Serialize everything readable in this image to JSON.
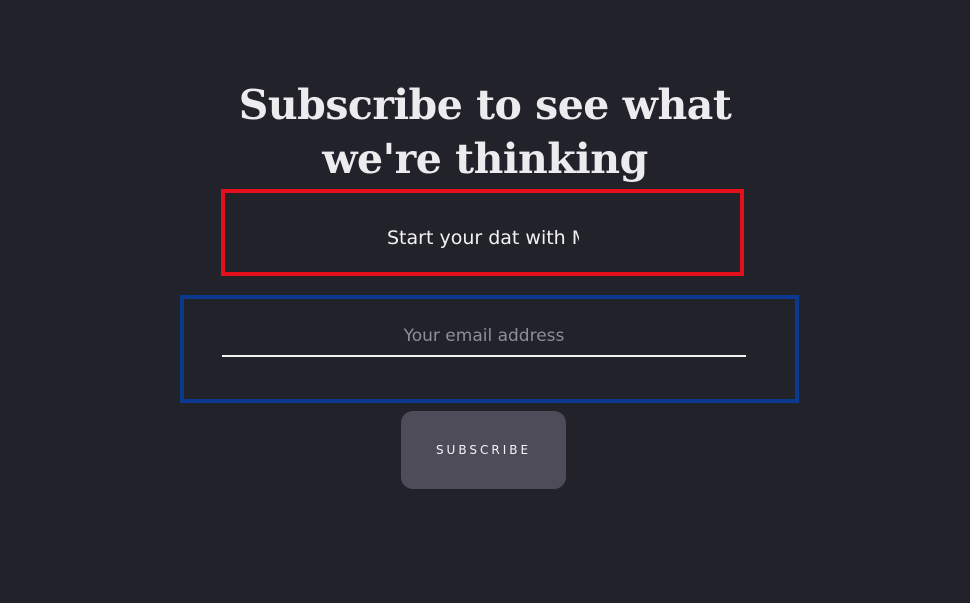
{
  "heading": {
    "line1": "Subscribe to see what",
    "line2": "we're thinking"
  },
  "tagline": {
    "text": "Start your dat with M"
  },
  "form": {
    "email_placeholder": "Your email address",
    "email_value": "",
    "subscribe_label": "SUBSCRIBE"
  },
  "colors": {
    "background": "#22232a",
    "tagline_border": "#e3101c",
    "email_border": "#0a3a8e",
    "button_bg": "#4d4c58"
  }
}
